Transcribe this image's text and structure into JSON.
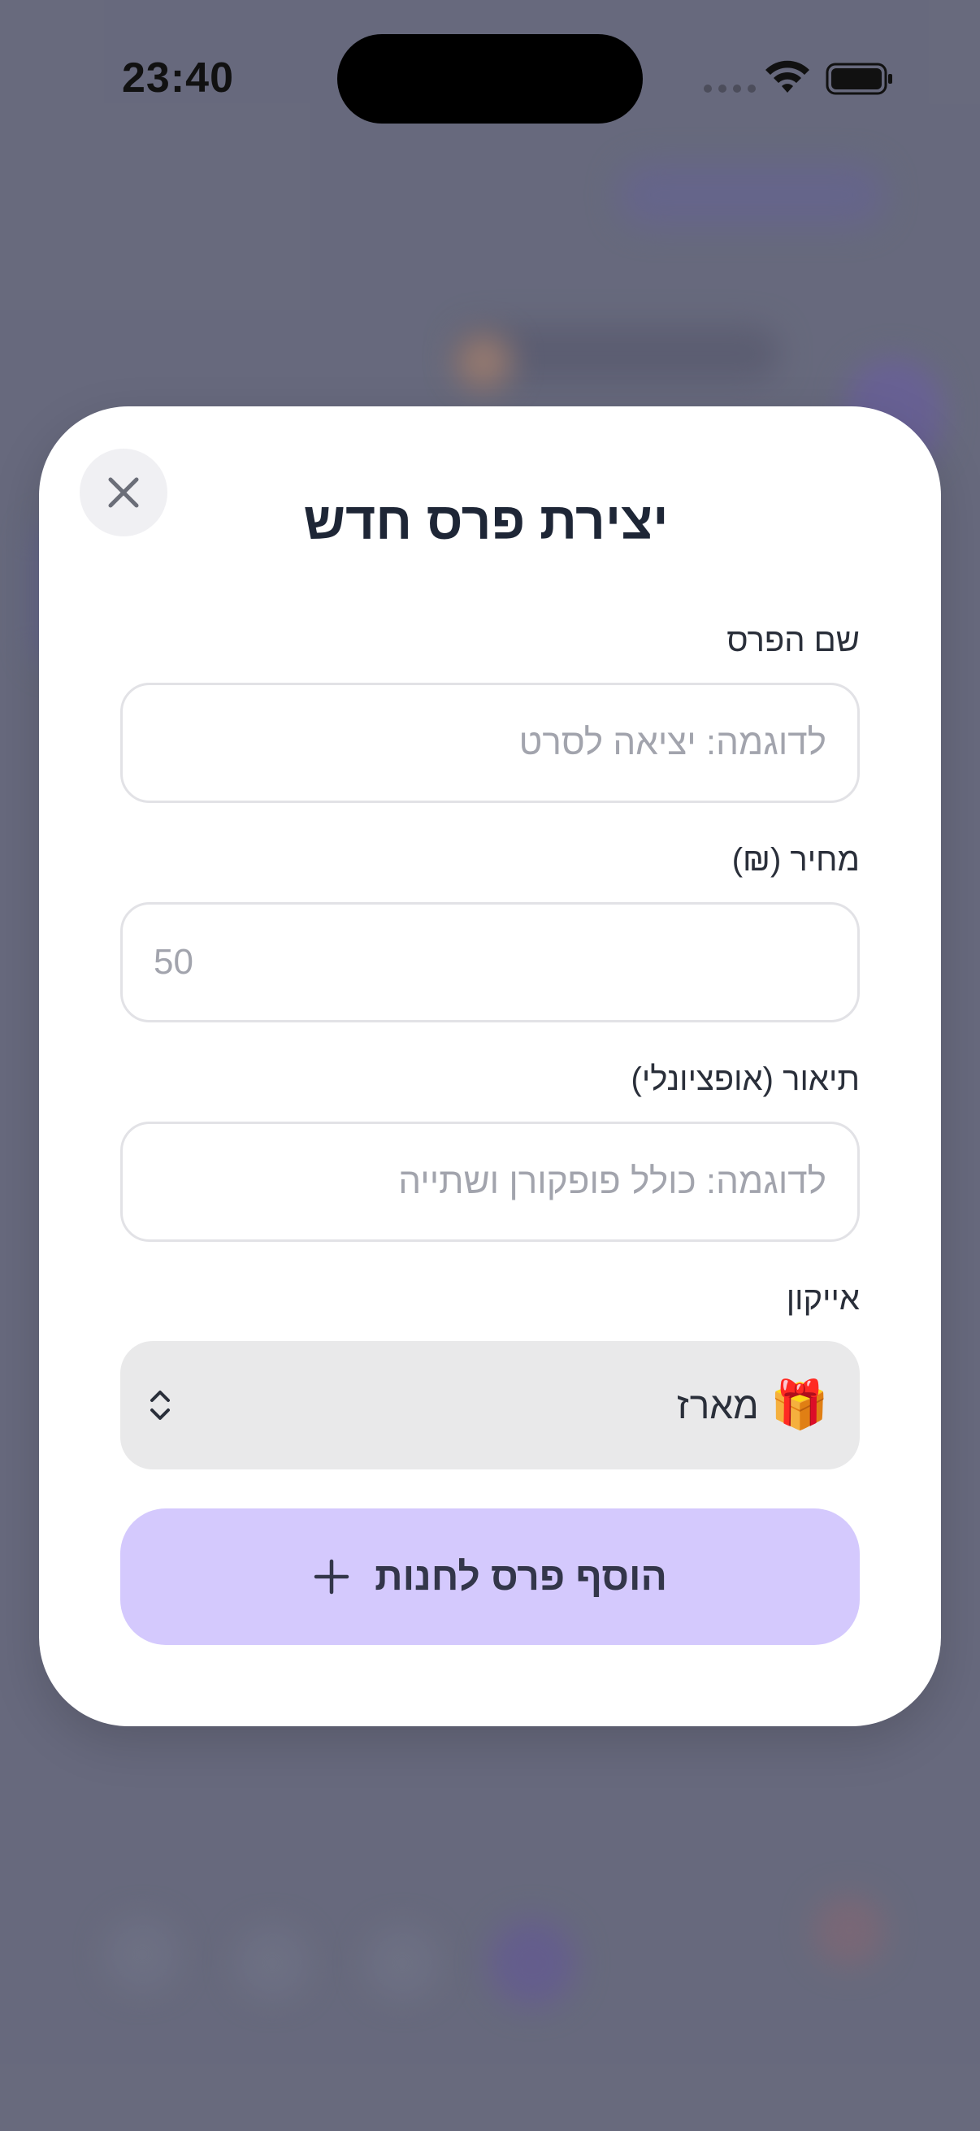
{
  "status_bar": {
    "time": "23:40"
  },
  "modal": {
    "title": "יצירת פרס חדש",
    "fields": {
      "name": {
        "label": "שם הפרס",
        "placeholder": "לדוגמה: יציאה לסרט"
      },
      "price": {
        "label": "מחיר (₪)",
        "placeholder": "50"
      },
      "description": {
        "label": "תיאור (אופציונלי)",
        "placeholder": "לדוגמה: כולל פופקורן ושתייה"
      },
      "icon": {
        "label": "אייקון",
        "selected_emoji": "🎁",
        "selected_label": "מארז"
      }
    },
    "submit_label": "הוסף פרס לחנות"
  },
  "colors": {
    "accent_button": "#d4c9fd",
    "title": "#1e2636",
    "overlay": "#6f7184"
  },
  "icons": [
    "close-icon",
    "plus-icon",
    "chevron-up-down-icon",
    "wifi-icon",
    "battery-icon"
  ]
}
